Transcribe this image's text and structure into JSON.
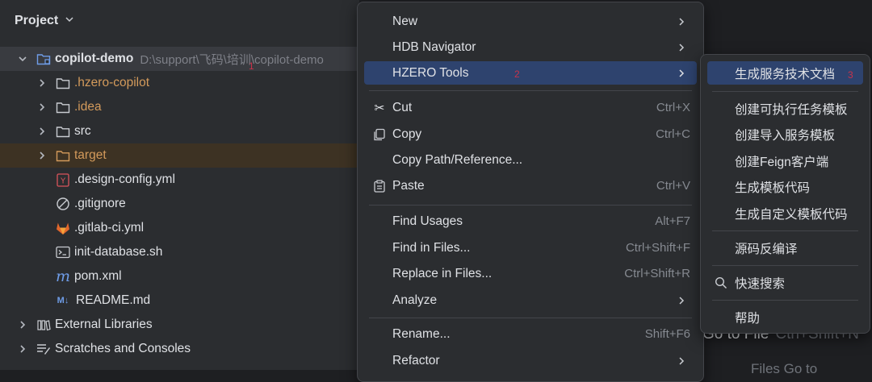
{
  "project_panel": {
    "title": "Project",
    "tree": [
      {
        "label": "copilot-demo",
        "path": "D:\\support\\飞码\\培训\\copilot-demo",
        "marker": "1"
      },
      {
        "label": ".hzero-copilot"
      },
      {
        "label": ".idea"
      },
      {
        "label": "src"
      },
      {
        "label": "target"
      },
      {
        "label": ".design-config.yml"
      },
      {
        "label": ".gitignore"
      },
      {
        "label": ".gitlab-ci.yml"
      },
      {
        "label": "init-database.sh"
      },
      {
        "label": "pom.xml"
      },
      {
        "label": "README.md"
      },
      {
        "label": "External Libraries"
      },
      {
        "label": "Scratches and Consoles"
      }
    ]
  },
  "background": {
    "goto_file": "Go to File",
    "goto_shortcut": "Ctrl+Shift+N",
    "bottom_hint": "Files Go to"
  },
  "context_menu": {
    "items": [
      {
        "label": "New"
      },
      {
        "label": "HDB Navigator"
      },
      {
        "label": "HZERO Tools",
        "marker": "2"
      },
      {
        "label": "Cut",
        "shortcut": "Ctrl+X"
      },
      {
        "label": "Copy",
        "shortcut": "Ctrl+C"
      },
      {
        "label": "Copy Path/Reference..."
      },
      {
        "label": "Paste",
        "shortcut": "Ctrl+V"
      },
      {
        "label": "Find Usages",
        "shortcut": "Alt+F7"
      },
      {
        "label": "Find in Files...",
        "shortcut": "Ctrl+Shift+F"
      },
      {
        "label": "Replace in Files...",
        "shortcut": "Ctrl+Shift+R"
      },
      {
        "label": "Analyze"
      },
      {
        "label": "Rename...",
        "shortcut": "Shift+F6"
      },
      {
        "label": "Refactor"
      }
    ]
  },
  "submenu": {
    "items": [
      {
        "label": "生成服务技术文档",
        "marker": "3"
      },
      {
        "label": "创建可执行任务模板"
      },
      {
        "label": "创建导入服务模板"
      },
      {
        "label": "创建Feign客户端"
      },
      {
        "label": "生成模板代码"
      },
      {
        "label": "生成自定义模板代码"
      },
      {
        "label": "源码反编译"
      },
      {
        "label": "快速搜索"
      },
      {
        "label": "帮助"
      }
    ]
  }
}
